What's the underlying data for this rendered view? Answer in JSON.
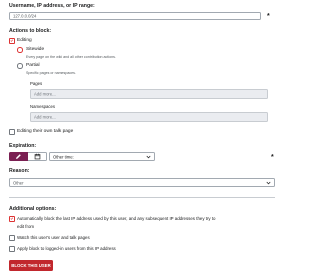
{
  "target": {
    "label": "Username, IP address, or IP range:",
    "value": "127.0.0.0/24",
    "required_mark": "*"
  },
  "actions": {
    "label": "Actions to block:",
    "editing": {
      "label": "Editing",
      "checked": true,
      "sitewide": {
        "label": "Sitewide",
        "description": "Every page on the wiki and all other contribution actions.",
        "selected": true
      },
      "partial": {
        "label": "Partial",
        "description": "Specific pages or namespaces.",
        "selected": false,
        "pages": {
          "label": "Pages",
          "placeholder": "Add more..."
        },
        "namespaces": {
          "label": "Namespaces",
          "placeholder": "Add more..."
        }
      }
    },
    "own_talk": {
      "label": "Editing their own talk page",
      "checked": false
    }
  },
  "expiration": {
    "label": "Expiration:",
    "select_value": "Other time:",
    "required_mark": "*",
    "active_mode": "infinite-icon"
  },
  "reason": {
    "label": "Reason:",
    "select_value": "Other"
  },
  "additional": {
    "label": "Additional options:",
    "autoblock": {
      "label_line1": "Automatically block the last IP address used by this user, and any subsequent IP addresses they try to",
      "label_line2": "edit from",
      "checked": true
    },
    "watch": {
      "label": "Watch this user's user and talk pages",
      "checked": false
    },
    "logged_in": {
      "label": "Apply block to logged-in users from this IP address",
      "checked": false
    }
  },
  "submit": {
    "label": "BLOCK THIS USER"
  },
  "colors": {
    "accent": "#d33333",
    "active_segment": "#7a1f52",
    "submit_bg": "#c1272d"
  }
}
